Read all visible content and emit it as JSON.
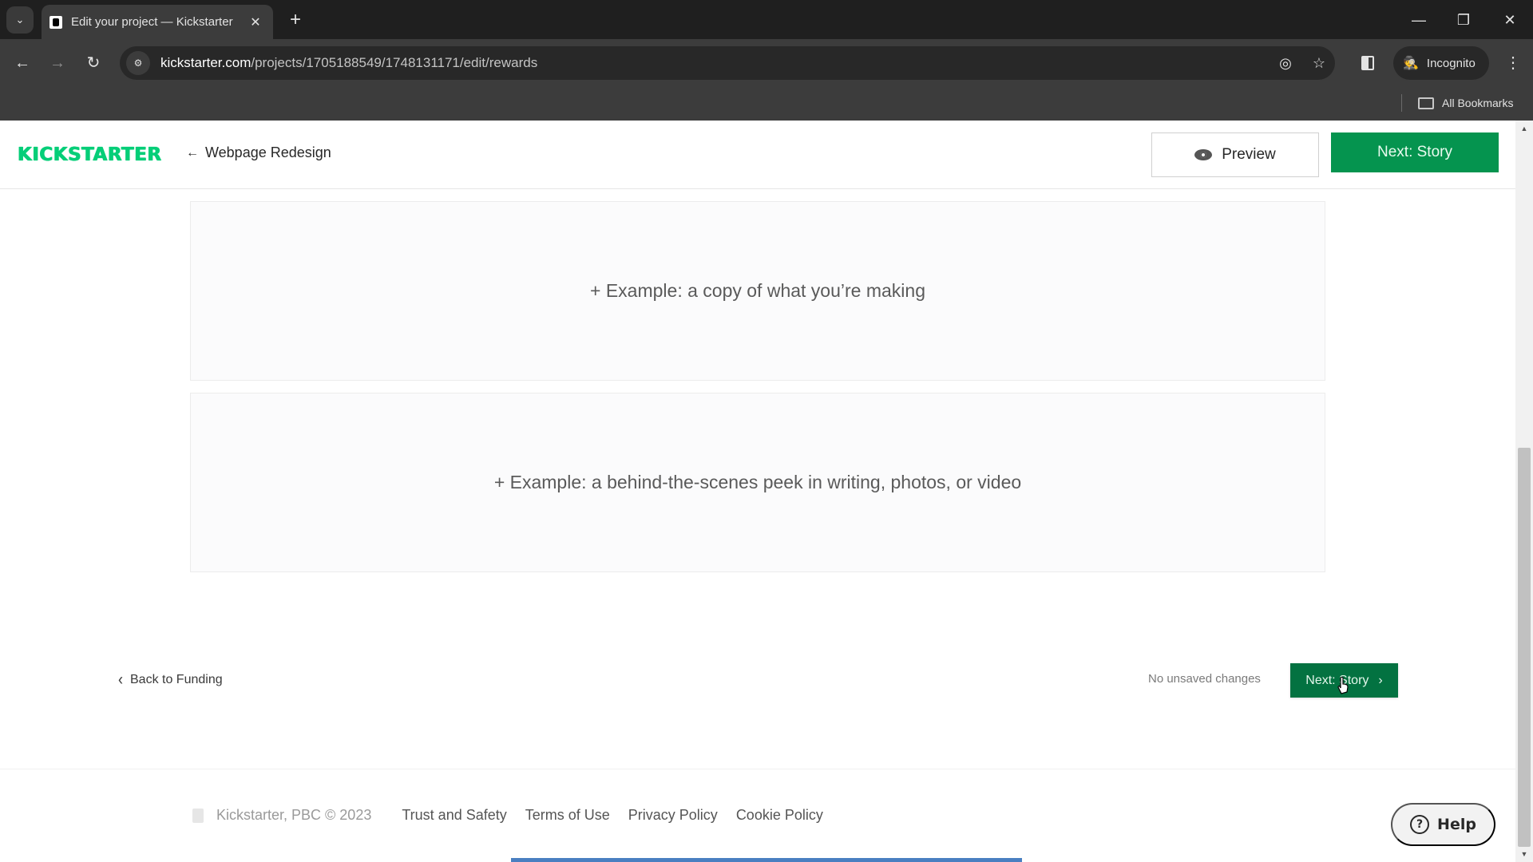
{
  "browser": {
    "tab_title": "Edit your project — Kickstarter",
    "url_host": "kickstarter.com",
    "url_path": "/projects/1705188549/1748131171/edit/rewards",
    "incognito_label": "Incognito",
    "bookmarks_label": "All Bookmarks",
    "icons": {
      "tab_list": "⌄",
      "close": "✕",
      "new_tab": "+",
      "minimize": "—",
      "restore": "❐",
      "window_close": "✕",
      "back": "←",
      "forward": "→",
      "reload": "↻",
      "site_info": "⚙",
      "eye_off": "◎",
      "star": "☆",
      "incognito": "🕵",
      "menu": "⋮"
    }
  },
  "header": {
    "logo": "KICKSTARTER",
    "back_arrow": "←",
    "project_name": "Webpage Redesign",
    "preview_label": "Preview",
    "next_label": "Next: Story"
  },
  "rewards": {
    "examples": [
      "+ Example: a copy of what you’re making",
      "+ Example: a behind-the-scenes peek in writing, photos, or video"
    ]
  },
  "bottom_nav": {
    "back_chevron": "‹",
    "back_label": "Back to Funding",
    "save_status": "No unsaved changes",
    "next_label": "Next: Story",
    "next_chevron": "›"
  },
  "footer": {
    "copyright": "Kickstarter, PBC © 2023",
    "links": [
      "Trust and Safety",
      "Terms of Use",
      "Privacy Policy",
      "Cookie Policy"
    ]
  },
  "help": {
    "icon": "?",
    "label": "Help"
  },
  "colors": {
    "brand_green": "#05ce78",
    "primary_button": "#05944f",
    "primary_button_dark": "#037241"
  }
}
